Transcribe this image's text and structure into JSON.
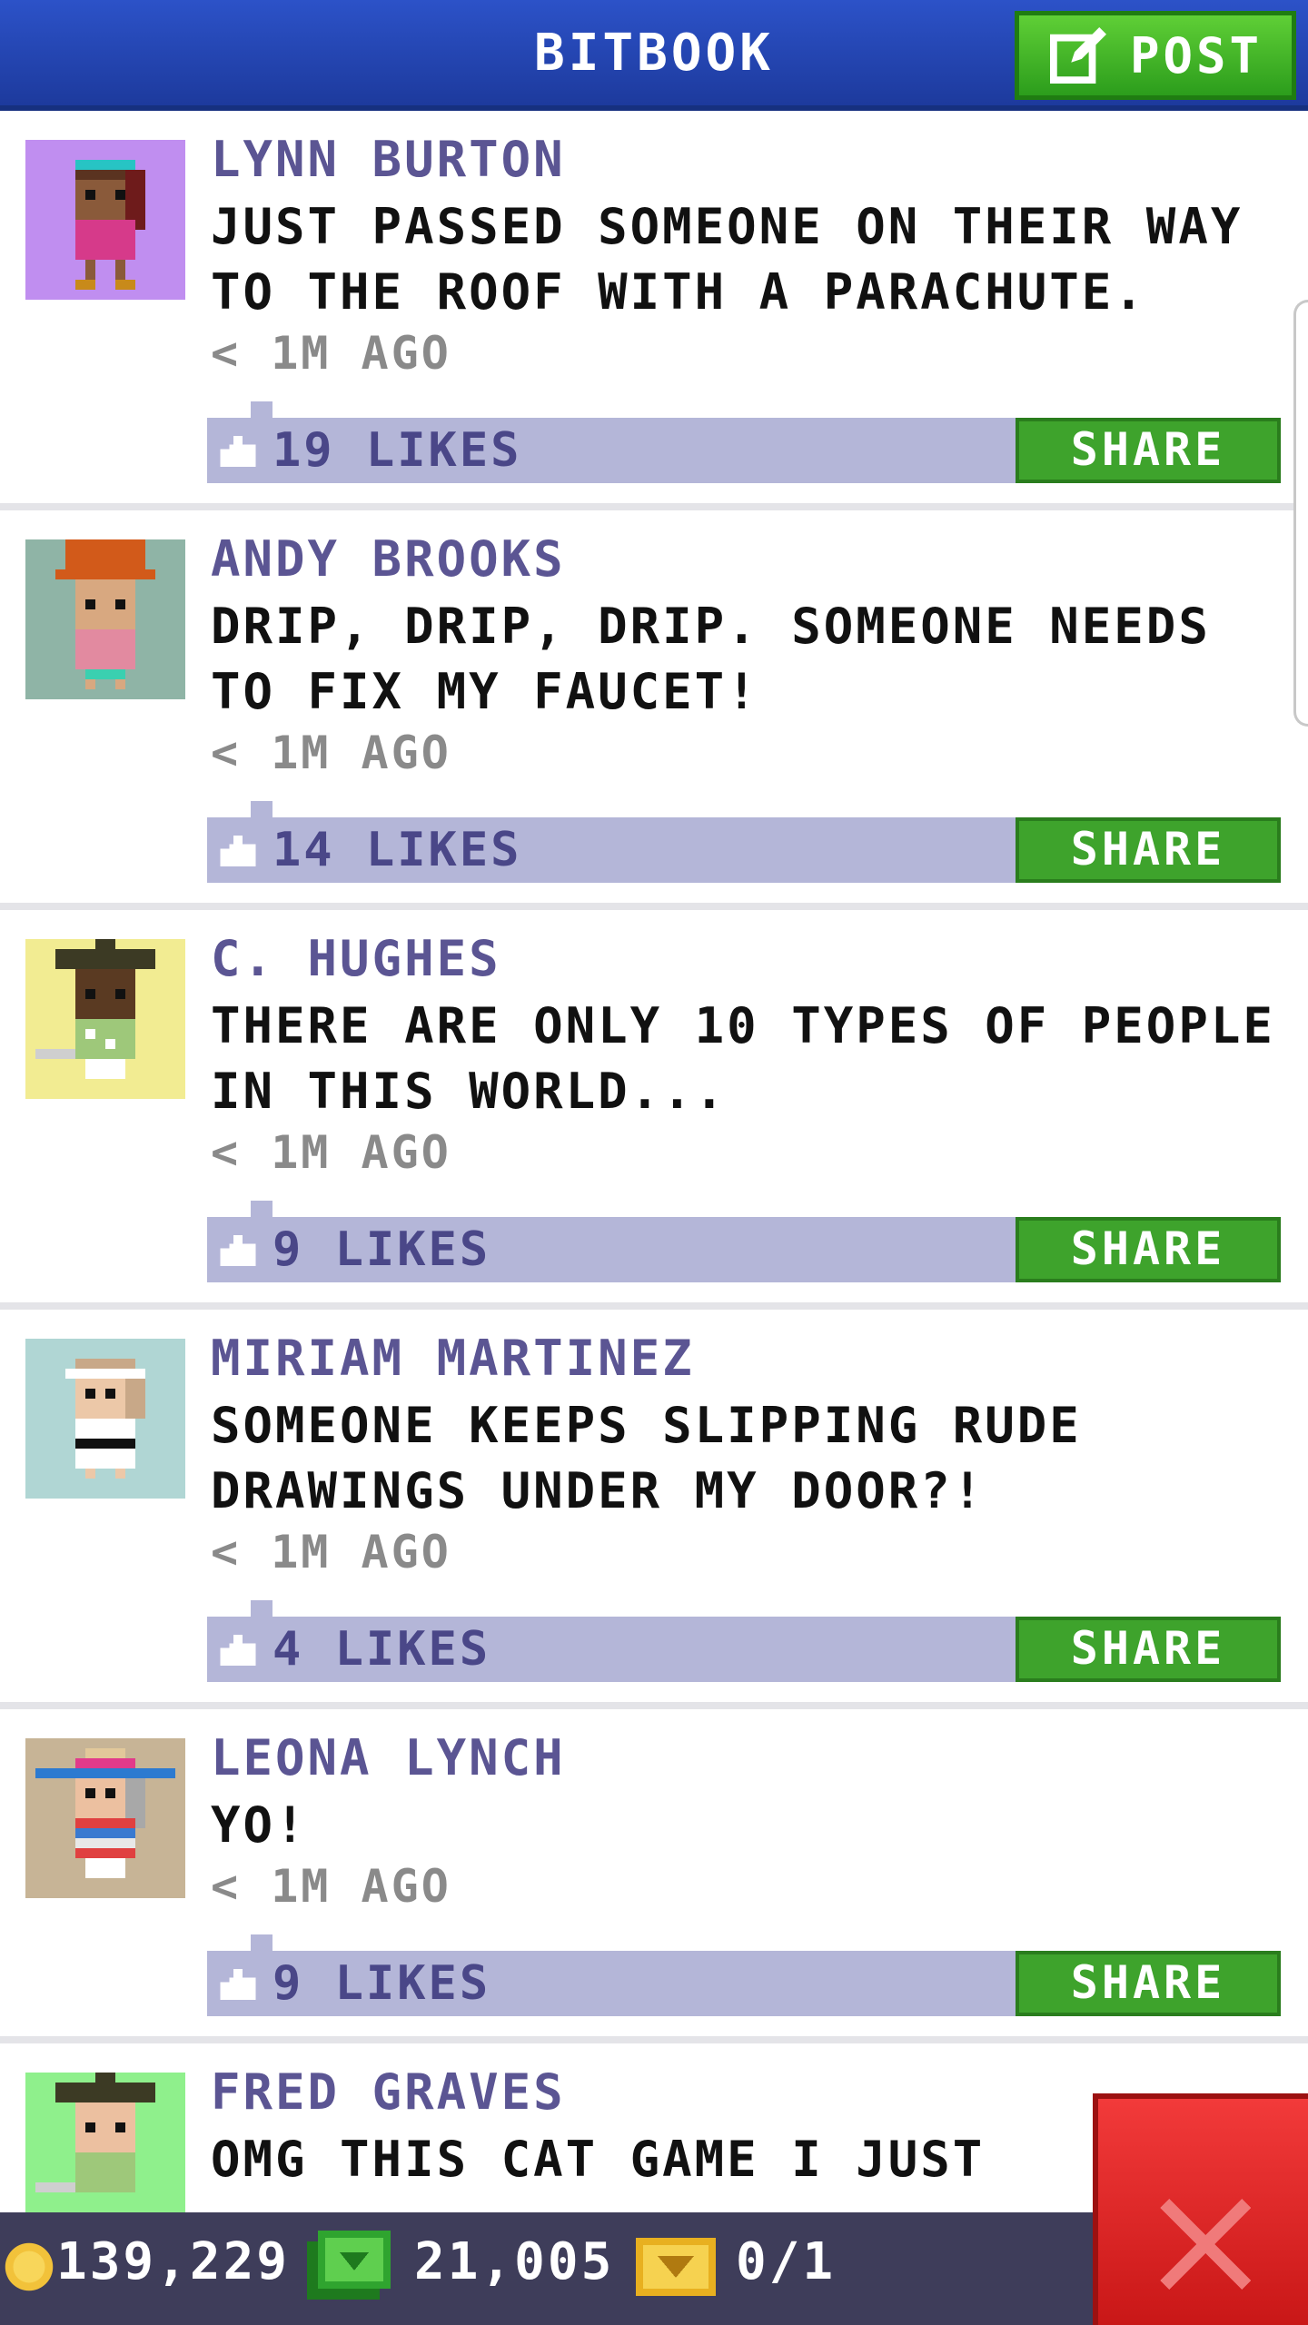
{
  "header": {
    "title": "BITBOOK",
    "post_label": "POST"
  },
  "posts": [
    {
      "author": "LYNN BURTON",
      "message": "JUST PASSED SOMEONE ON THEIR WAY TO THE ROOF WITH A PARACHUTE.",
      "time": "< 1M AGO",
      "likes": "19 LIKES",
      "share_label": "SHARE",
      "avatar_bg": "#c08ef0"
    },
    {
      "author": "ANDY BROOKS",
      "message": "DRIP, DRIP, DRIP. SOMEONE NEEDS TO FIX MY FAUCET!",
      "time": "< 1M AGO",
      "likes": "14 LIKES",
      "share_label": "SHARE",
      "avatar_bg": "#8fb4a6"
    },
    {
      "author": "C. HUGHES",
      "message": "THERE ARE ONLY 10 TYPES OF PEOPLE IN THIS WORLD...",
      "time": "< 1M AGO",
      "likes": "9 LIKES",
      "share_label": "SHARE",
      "avatar_bg": "#f2ec92"
    },
    {
      "author": "MIRIAM MARTINEZ",
      "message": "SOMEONE KEEPS SLIPPING RUDE DRAWINGS UNDER MY DOOR?!",
      "time": "< 1M AGO",
      "likes": "4 LIKES",
      "share_label": "SHARE",
      "avatar_bg": "#b0d6d4"
    },
    {
      "author": "LEONA LYNCH",
      "message": "YO!",
      "time": "< 1M AGO",
      "likes": "9 LIKES",
      "share_label": "SHARE",
      "avatar_bg": "#c7b496"
    },
    {
      "author": "FRED GRAVES",
      "message": "OMG THIS CAT GAME I JUST",
      "avatar_bg": "#8ff08c"
    }
  ],
  "bottom_bar": {
    "coins": "139,229",
    "bux": "21,005",
    "tickets": "0/1"
  },
  "colors": {
    "header": "#2343b0",
    "post_button": "#3db024",
    "share_button": "#3ea32c",
    "likes_bar": "#b4b6d8",
    "author": "#5b5593",
    "close_button": "#e02424"
  },
  "icons": {
    "post": "edit-icon",
    "like": "thumbs-up-icon",
    "coin": "coin-icon",
    "bux": "bux-icon",
    "ticket": "ticket-icon",
    "close": "close-icon"
  }
}
